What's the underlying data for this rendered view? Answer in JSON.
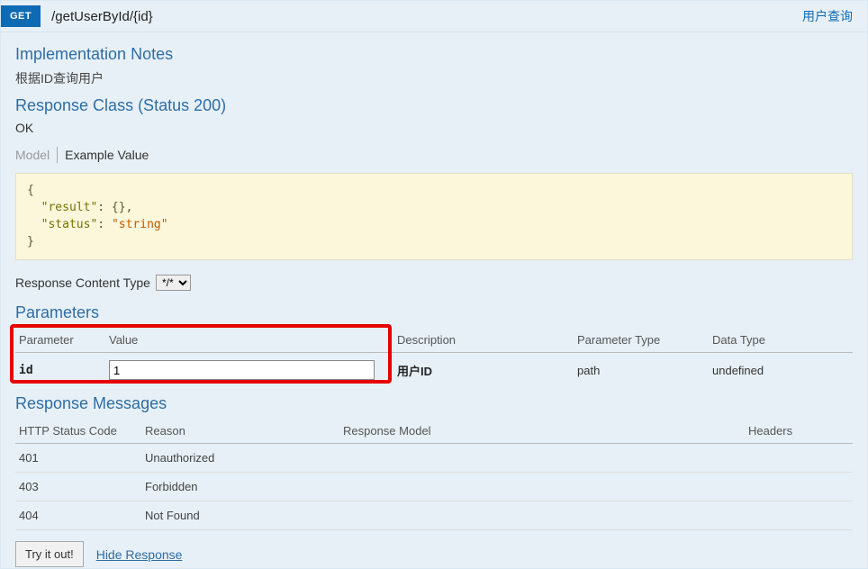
{
  "header": {
    "method": "GET",
    "path": "/getUserById/{id}",
    "summary": "用户查询"
  },
  "notes": {
    "title": "Implementation Notes",
    "text": "根据ID查询用户"
  },
  "responseClass": {
    "title": "Response Class (Status 200)",
    "status": "OK",
    "tab_model": "Model",
    "tab_example": "Example Value",
    "example": "{\n  \"result\": {},\n  \"status\": \"string\"\n}"
  },
  "contentType": {
    "label": "Response Content Type",
    "value": "*/*"
  },
  "parameters": {
    "title": "Parameters",
    "headers": {
      "parameter": "Parameter",
      "value": "Value",
      "description": "Description",
      "paramType": "Parameter Type",
      "dataType": "Data Type"
    },
    "rows": [
      {
        "name": "id",
        "value": "1",
        "description": "用户ID",
        "paramType": "path",
        "dataType": "undefined"
      }
    ]
  },
  "responseMessages": {
    "title": "Response Messages",
    "headers": {
      "code": "HTTP Status Code",
      "reason": "Reason",
      "model": "Response Model",
      "headers": "Headers"
    },
    "rows": [
      {
        "code": "401",
        "reason": "Unauthorized"
      },
      {
        "code": "403",
        "reason": "Forbidden"
      },
      {
        "code": "404",
        "reason": "Not Found"
      }
    ]
  },
  "actions": {
    "tryItOut": "Try it out!",
    "hideResponse": "Hide Response"
  }
}
